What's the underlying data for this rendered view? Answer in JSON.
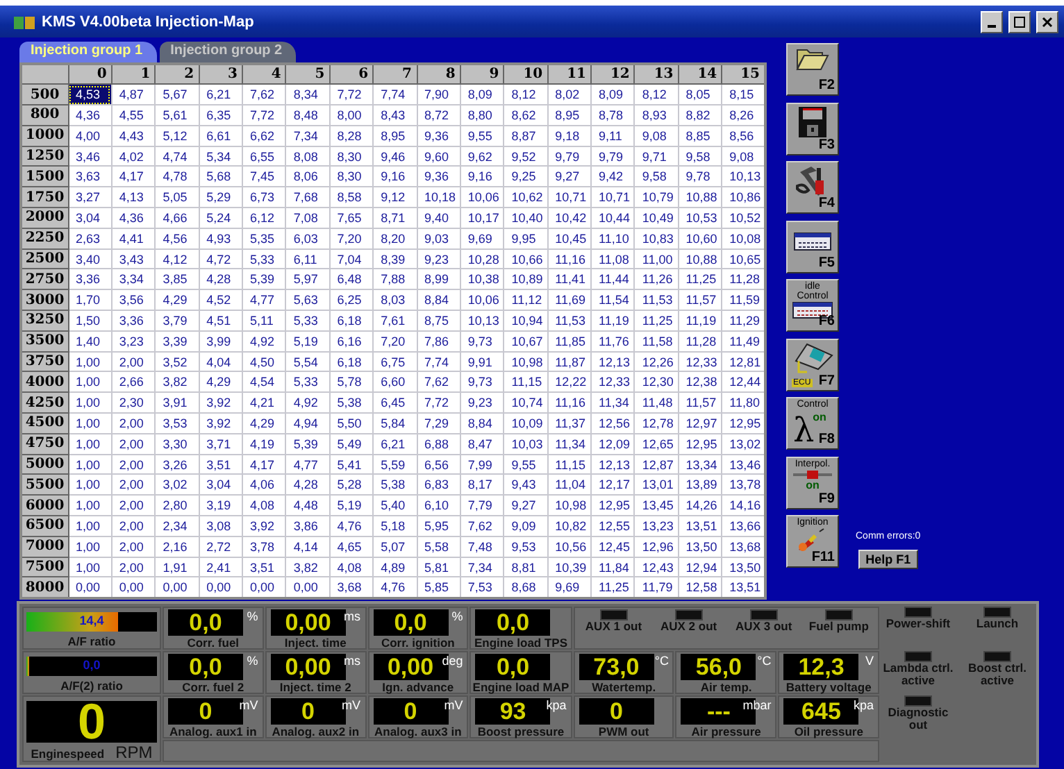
{
  "window": {
    "title": "KMS V4.00beta Injection-Map"
  },
  "tabs": [
    {
      "label": "Injection group 1",
      "selected": true
    },
    {
      "label": "Injection group 2",
      "selected": false
    }
  ],
  "table": {
    "columns": [
      "0",
      "1",
      "2",
      "3",
      "4",
      "5",
      "6",
      "7",
      "8",
      "9",
      "10",
      "11",
      "12",
      "13",
      "14",
      "15"
    ],
    "rows": [
      {
        "label": "500",
        "cells": [
          {
            "value": "4,53",
            "selected": true
          },
          {
            "value": "4,87",
            "selected": false
          },
          {
            "value": "5,67",
            "selected": false
          },
          {
            "value": "6,21",
            "selected": false
          },
          {
            "value": "7,62",
            "selected": false
          },
          {
            "value": "8,34",
            "selected": false
          },
          {
            "value": "7,72",
            "selected": false
          },
          {
            "value": "7,74",
            "selected": false
          },
          {
            "value": "7,90",
            "selected": false
          },
          {
            "value": "8,09",
            "selected": false
          },
          {
            "value": "8,12",
            "selected": false
          },
          {
            "value": "8,02",
            "selected": false
          },
          {
            "value": "8,09",
            "selected": false
          },
          {
            "value": "8,12",
            "selected": false
          },
          {
            "value": "8,05",
            "selected": false
          },
          {
            "value": "8,15",
            "selected": false
          }
        ]
      },
      {
        "label": "800",
        "cells": [
          {
            "value": "4,36",
            "selected": false
          },
          {
            "value": "4,55",
            "selected": false
          },
          {
            "value": "5,61",
            "selected": false
          },
          {
            "value": "6,35",
            "selected": false
          },
          {
            "value": "7,72",
            "selected": false
          },
          {
            "value": "8,48",
            "selected": false
          },
          {
            "value": "8,00",
            "selected": false
          },
          {
            "value": "8,43",
            "selected": false
          },
          {
            "value": "8,72",
            "selected": false
          },
          {
            "value": "8,80",
            "selected": false
          },
          {
            "value": "8,62",
            "selected": false
          },
          {
            "value": "8,95",
            "selected": false
          },
          {
            "value": "8,78",
            "selected": false
          },
          {
            "value": "8,93",
            "selected": false
          },
          {
            "value": "8,82",
            "selected": false
          },
          {
            "value": "8,26",
            "selected": false
          }
        ]
      },
      {
        "label": "1000",
        "cells": [
          {
            "value": "4,00",
            "selected": false
          },
          {
            "value": "4,43",
            "selected": false
          },
          {
            "value": "5,12",
            "selected": false
          },
          {
            "value": "6,61",
            "selected": false
          },
          {
            "value": "6,62",
            "selected": false
          },
          {
            "value": "7,34",
            "selected": false
          },
          {
            "value": "8,28",
            "selected": false
          },
          {
            "value": "8,95",
            "selected": false
          },
          {
            "value": "9,36",
            "selected": false
          },
          {
            "value": "9,55",
            "selected": false
          },
          {
            "value": "8,87",
            "selected": false
          },
          {
            "value": "9,18",
            "selected": false
          },
          {
            "value": "9,11",
            "selected": false
          },
          {
            "value": "9,08",
            "selected": false
          },
          {
            "value": "8,85",
            "selected": false
          },
          {
            "value": "8,56",
            "selected": false
          }
        ]
      },
      {
        "label": "1250",
        "cells": [
          {
            "value": "3,46",
            "selected": false
          },
          {
            "value": "4,02",
            "selected": false
          },
          {
            "value": "4,74",
            "selected": false
          },
          {
            "value": "5,34",
            "selected": false
          },
          {
            "value": "6,55",
            "selected": false
          },
          {
            "value": "8,08",
            "selected": false
          },
          {
            "value": "8,30",
            "selected": false
          },
          {
            "value": "9,46",
            "selected": false
          },
          {
            "value": "9,60",
            "selected": false
          },
          {
            "value": "9,62",
            "selected": false
          },
          {
            "value": "9,52",
            "selected": false
          },
          {
            "value": "9,79",
            "selected": false
          },
          {
            "value": "9,79",
            "selected": false
          },
          {
            "value": "9,71",
            "selected": false
          },
          {
            "value": "9,58",
            "selected": false
          },
          {
            "value": "9,08",
            "selected": false
          }
        ]
      },
      {
        "label": "1500",
        "cells": [
          {
            "value": "3,63",
            "selected": false
          },
          {
            "value": "4,17",
            "selected": false
          },
          {
            "value": "4,78",
            "selected": false
          },
          {
            "value": "5,68",
            "selected": false
          },
          {
            "value": "7,45",
            "selected": false
          },
          {
            "value": "8,06",
            "selected": false
          },
          {
            "value": "8,30",
            "selected": false
          },
          {
            "value": "9,16",
            "selected": false
          },
          {
            "value": "9,36",
            "selected": false
          },
          {
            "value": "9,16",
            "selected": false
          },
          {
            "value": "9,25",
            "selected": false
          },
          {
            "value": "9,27",
            "selected": false
          },
          {
            "value": "9,42",
            "selected": false
          },
          {
            "value": "9,58",
            "selected": false
          },
          {
            "value": "9,78",
            "selected": false
          },
          {
            "value": "10,13",
            "selected": false
          }
        ]
      },
      {
        "label": "1750",
        "cells": [
          {
            "value": "3,27",
            "selected": false
          },
          {
            "value": "4,13",
            "selected": false
          },
          {
            "value": "5,05",
            "selected": false
          },
          {
            "value": "5,29",
            "selected": false
          },
          {
            "value": "6,73",
            "selected": false
          },
          {
            "value": "7,68",
            "selected": false
          },
          {
            "value": "8,58",
            "selected": false
          },
          {
            "value": "9,12",
            "selected": false
          },
          {
            "value": "10,18",
            "selected": false
          },
          {
            "value": "10,06",
            "selected": false
          },
          {
            "value": "10,62",
            "selected": false
          },
          {
            "value": "10,71",
            "selected": false
          },
          {
            "value": "10,71",
            "selected": false
          },
          {
            "value": "10,79",
            "selected": false
          },
          {
            "value": "10,88",
            "selected": false
          },
          {
            "value": "10,86",
            "selected": false
          }
        ]
      },
      {
        "label": "2000",
        "cells": [
          {
            "value": "3,04",
            "selected": false
          },
          {
            "value": "4,36",
            "selected": false
          },
          {
            "value": "4,66",
            "selected": false
          },
          {
            "value": "5,24",
            "selected": false
          },
          {
            "value": "6,12",
            "selected": false
          },
          {
            "value": "7,08",
            "selected": false
          },
          {
            "value": "7,65",
            "selected": false
          },
          {
            "value": "8,71",
            "selected": false
          },
          {
            "value": "9,40",
            "selected": false
          },
          {
            "value": "10,17",
            "selected": false
          },
          {
            "value": "10,40",
            "selected": false
          },
          {
            "value": "10,42",
            "selected": false
          },
          {
            "value": "10,44",
            "selected": false
          },
          {
            "value": "10,49",
            "selected": false
          },
          {
            "value": "10,53",
            "selected": false
          },
          {
            "value": "10,52",
            "selected": false
          }
        ]
      },
      {
        "label": "2250",
        "cells": [
          {
            "value": "2,63",
            "selected": false
          },
          {
            "value": "4,41",
            "selected": false
          },
          {
            "value": "4,56",
            "selected": false
          },
          {
            "value": "4,93",
            "selected": false
          },
          {
            "value": "5,35",
            "selected": false
          },
          {
            "value": "6,03",
            "selected": false
          },
          {
            "value": "7,20",
            "selected": false
          },
          {
            "value": "8,20",
            "selected": false
          },
          {
            "value": "9,03",
            "selected": false
          },
          {
            "value": "9,69",
            "selected": false
          },
          {
            "value": "9,95",
            "selected": false
          },
          {
            "value": "10,45",
            "selected": false
          },
          {
            "value": "11,10",
            "selected": false
          },
          {
            "value": "10,83",
            "selected": false
          },
          {
            "value": "10,60",
            "selected": false
          },
          {
            "value": "10,08",
            "selected": false
          }
        ]
      },
      {
        "label": "2500",
        "cells": [
          {
            "value": "3,40",
            "selected": false
          },
          {
            "value": "3,43",
            "selected": false
          },
          {
            "value": "4,12",
            "selected": false
          },
          {
            "value": "4,72",
            "selected": false
          },
          {
            "value": "5,33",
            "selected": false
          },
          {
            "value": "6,11",
            "selected": false
          },
          {
            "value": "7,04",
            "selected": false
          },
          {
            "value": "8,39",
            "selected": false
          },
          {
            "value": "9,23",
            "selected": false
          },
          {
            "value": "10,28",
            "selected": false
          },
          {
            "value": "10,66",
            "selected": false
          },
          {
            "value": "11,16",
            "selected": false
          },
          {
            "value": "11,08",
            "selected": false
          },
          {
            "value": "11,00",
            "selected": false
          },
          {
            "value": "10,88",
            "selected": false
          },
          {
            "value": "10,65",
            "selected": false
          }
        ]
      },
      {
        "label": "2750",
        "cells": [
          {
            "value": "3,36",
            "selected": false
          },
          {
            "value": "3,34",
            "selected": false
          },
          {
            "value": "3,85",
            "selected": false
          },
          {
            "value": "4,28",
            "selected": false
          },
          {
            "value": "5,39",
            "selected": false
          },
          {
            "value": "5,97",
            "selected": false
          },
          {
            "value": "6,48",
            "selected": false
          },
          {
            "value": "7,88",
            "selected": false
          },
          {
            "value": "8,99",
            "selected": false
          },
          {
            "value": "10,38",
            "selected": false
          },
          {
            "value": "10,89",
            "selected": false
          },
          {
            "value": "11,41",
            "selected": false
          },
          {
            "value": "11,44",
            "selected": false
          },
          {
            "value": "11,26",
            "selected": false
          },
          {
            "value": "11,25",
            "selected": false
          },
          {
            "value": "11,28",
            "selected": false
          }
        ]
      },
      {
        "label": "3000",
        "cells": [
          {
            "value": "1,70",
            "selected": false
          },
          {
            "value": "3,56",
            "selected": false
          },
          {
            "value": "4,29",
            "selected": false
          },
          {
            "value": "4,52",
            "selected": false
          },
          {
            "value": "4,77",
            "selected": false
          },
          {
            "value": "5,63",
            "selected": false
          },
          {
            "value": "6,25",
            "selected": false
          },
          {
            "value": "8,03",
            "selected": false
          },
          {
            "value": "8,84",
            "selected": false
          },
          {
            "value": "10,06",
            "selected": false
          },
          {
            "value": "11,12",
            "selected": false
          },
          {
            "value": "11,69",
            "selected": false
          },
          {
            "value": "11,54",
            "selected": false
          },
          {
            "value": "11,53",
            "selected": false
          },
          {
            "value": "11,57",
            "selected": false
          },
          {
            "value": "11,59",
            "selected": false
          }
        ]
      },
      {
        "label": "3250",
        "cells": [
          {
            "value": "1,50",
            "selected": false
          },
          {
            "value": "3,36",
            "selected": false
          },
          {
            "value": "3,79",
            "selected": false
          },
          {
            "value": "4,51",
            "selected": false
          },
          {
            "value": "5,11",
            "selected": false
          },
          {
            "value": "5,33",
            "selected": false
          },
          {
            "value": "6,18",
            "selected": false
          },
          {
            "value": "7,61",
            "selected": false
          },
          {
            "value": "8,75",
            "selected": false
          },
          {
            "value": "10,13",
            "selected": false
          },
          {
            "value": "10,94",
            "selected": false
          },
          {
            "value": "11,53",
            "selected": false
          },
          {
            "value": "11,19",
            "selected": false
          },
          {
            "value": "11,25",
            "selected": false
          },
          {
            "value": "11,19",
            "selected": false
          },
          {
            "value": "11,29",
            "selected": false
          }
        ]
      },
      {
        "label": "3500",
        "cells": [
          {
            "value": "1,40",
            "selected": false
          },
          {
            "value": "3,23",
            "selected": false
          },
          {
            "value": "3,39",
            "selected": false
          },
          {
            "value": "3,99",
            "selected": false
          },
          {
            "value": "4,92",
            "selected": false
          },
          {
            "value": "5,19",
            "selected": false
          },
          {
            "value": "6,16",
            "selected": false
          },
          {
            "value": "7,20",
            "selected": false
          },
          {
            "value": "7,86",
            "selected": false
          },
          {
            "value": "9,73",
            "selected": false
          },
          {
            "value": "10,67",
            "selected": false
          },
          {
            "value": "11,85",
            "selected": false
          },
          {
            "value": "11,76",
            "selected": false
          },
          {
            "value": "11,58",
            "selected": false
          },
          {
            "value": "11,28",
            "selected": false
          },
          {
            "value": "11,49",
            "selected": false
          }
        ]
      },
      {
        "label": "3750",
        "cells": [
          {
            "value": "1,00",
            "selected": false
          },
          {
            "value": "2,00",
            "selected": false
          },
          {
            "value": "3,52",
            "selected": false
          },
          {
            "value": "4,04",
            "selected": false
          },
          {
            "value": "4,50",
            "selected": false
          },
          {
            "value": "5,54",
            "selected": false
          },
          {
            "value": "6,18",
            "selected": false
          },
          {
            "value": "6,75",
            "selected": false
          },
          {
            "value": "7,74",
            "selected": false
          },
          {
            "value": "9,91",
            "selected": false
          },
          {
            "value": "10,98",
            "selected": false
          },
          {
            "value": "11,87",
            "selected": false
          },
          {
            "value": "12,13",
            "selected": false
          },
          {
            "value": "12,26",
            "selected": false
          },
          {
            "value": "12,33",
            "selected": false
          },
          {
            "value": "12,81",
            "selected": false
          }
        ]
      },
      {
        "label": "4000",
        "cells": [
          {
            "value": "1,00",
            "selected": false
          },
          {
            "value": "2,66",
            "selected": false
          },
          {
            "value": "3,82",
            "selected": false
          },
          {
            "value": "4,29",
            "selected": false
          },
          {
            "value": "4,54",
            "selected": false
          },
          {
            "value": "5,33",
            "selected": false
          },
          {
            "value": "5,78",
            "selected": false
          },
          {
            "value": "6,60",
            "selected": false
          },
          {
            "value": "7,62",
            "selected": false
          },
          {
            "value": "9,73",
            "selected": false
          },
          {
            "value": "11,15",
            "selected": false
          },
          {
            "value": "12,22",
            "selected": false
          },
          {
            "value": "12,33",
            "selected": false
          },
          {
            "value": "12,30",
            "selected": false
          },
          {
            "value": "12,38",
            "selected": false
          },
          {
            "value": "12,44",
            "selected": false
          }
        ]
      },
      {
        "label": "4250",
        "cells": [
          {
            "value": "1,00",
            "selected": false
          },
          {
            "value": "2,30",
            "selected": false
          },
          {
            "value": "3,91",
            "selected": false
          },
          {
            "value": "3,92",
            "selected": false
          },
          {
            "value": "4,21",
            "selected": false
          },
          {
            "value": "4,92",
            "selected": false
          },
          {
            "value": "5,38",
            "selected": false
          },
          {
            "value": "6,45",
            "selected": false
          },
          {
            "value": "7,72",
            "selected": false
          },
          {
            "value": "9,23",
            "selected": false
          },
          {
            "value": "10,74",
            "selected": false
          },
          {
            "value": "11,16",
            "selected": false
          },
          {
            "value": "11,34",
            "selected": false
          },
          {
            "value": "11,48",
            "selected": false
          },
          {
            "value": "11,57",
            "selected": false
          },
          {
            "value": "11,80",
            "selected": false
          }
        ]
      },
      {
        "label": "4500",
        "cells": [
          {
            "value": "1,00",
            "selected": false
          },
          {
            "value": "2,00",
            "selected": false
          },
          {
            "value": "3,53",
            "selected": false
          },
          {
            "value": "3,92",
            "selected": false
          },
          {
            "value": "4,29",
            "selected": false
          },
          {
            "value": "4,94",
            "selected": false
          },
          {
            "value": "5,50",
            "selected": false
          },
          {
            "value": "5,84",
            "selected": false
          },
          {
            "value": "7,29",
            "selected": false
          },
          {
            "value": "8,84",
            "selected": false
          },
          {
            "value": "10,09",
            "selected": false
          },
          {
            "value": "11,37",
            "selected": false
          },
          {
            "value": "12,56",
            "selected": false
          },
          {
            "value": "12,78",
            "selected": false
          },
          {
            "value": "12,97",
            "selected": false
          },
          {
            "value": "12,95",
            "selected": false
          }
        ]
      },
      {
        "label": "4750",
        "cells": [
          {
            "value": "1,00",
            "selected": false
          },
          {
            "value": "2,00",
            "selected": false
          },
          {
            "value": "3,30",
            "selected": false
          },
          {
            "value": "3,71",
            "selected": false
          },
          {
            "value": "4,19",
            "selected": false
          },
          {
            "value": "5,39",
            "selected": false
          },
          {
            "value": "5,49",
            "selected": false
          },
          {
            "value": "6,21",
            "selected": false
          },
          {
            "value": "6,88",
            "selected": false
          },
          {
            "value": "8,47",
            "selected": false
          },
          {
            "value": "10,03",
            "selected": false
          },
          {
            "value": "11,34",
            "selected": false
          },
          {
            "value": "12,09",
            "selected": false
          },
          {
            "value": "12,65",
            "selected": false
          },
          {
            "value": "12,95",
            "selected": false
          },
          {
            "value": "13,02",
            "selected": false
          }
        ]
      },
      {
        "label": "5000",
        "cells": [
          {
            "value": "1,00",
            "selected": false
          },
          {
            "value": "2,00",
            "selected": false
          },
          {
            "value": "3,26",
            "selected": false
          },
          {
            "value": "3,51",
            "selected": false
          },
          {
            "value": "4,17",
            "selected": false
          },
          {
            "value": "4,77",
            "selected": false
          },
          {
            "value": "5,41",
            "selected": false
          },
          {
            "value": "5,59",
            "selected": false
          },
          {
            "value": "6,56",
            "selected": false
          },
          {
            "value": "7,99",
            "selected": false
          },
          {
            "value": "9,55",
            "selected": false
          },
          {
            "value": "11,15",
            "selected": false
          },
          {
            "value": "12,13",
            "selected": false
          },
          {
            "value": "12,87",
            "selected": false
          },
          {
            "value": "13,34",
            "selected": false
          },
          {
            "value": "13,46",
            "selected": false
          }
        ]
      },
      {
        "label": "5500",
        "cells": [
          {
            "value": "1,00",
            "selected": false
          },
          {
            "value": "2,00",
            "selected": false
          },
          {
            "value": "3,02",
            "selected": false
          },
          {
            "value": "3,04",
            "selected": false
          },
          {
            "value": "4,06",
            "selected": false
          },
          {
            "value": "4,28",
            "selected": false
          },
          {
            "value": "5,28",
            "selected": false
          },
          {
            "value": "5,38",
            "selected": false
          },
          {
            "value": "6,83",
            "selected": false
          },
          {
            "value": "8,17",
            "selected": false
          },
          {
            "value": "9,43",
            "selected": false
          },
          {
            "value": "11,04",
            "selected": false
          },
          {
            "value": "12,17",
            "selected": false
          },
          {
            "value": "13,01",
            "selected": false
          },
          {
            "value": "13,89",
            "selected": false
          },
          {
            "value": "13,78",
            "selected": false
          }
        ]
      },
      {
        "label": "6000",
        "cells": [
          {
            "value": "1,00",
            "selected": false
          },
          {
            "value": "2,00",
            "selected": false
          },
          {
            "value": "2,80",
            "selected": false
          },
          {
            "value": "3,19",
            "selected": false
          },
          {
            "value": "4,08",
            "selected": false
          },
          {
            "value": "4,48",
            "selected": false
          },
          {
            "value": "5,19",
            "selected": false
          },
          {
            "value": "5,40",
            "selected": false
          },
          {
            "value": "6,10",
            "selected": false
          },
          {
            "value": "7,79",
            "selected": false
          },
          {
            "value": "9,27",
            "selected": false
          },
          {
            "value": "10,98",
            "selected": false
          },
          {
            "value": "12,95",
            "selected": false
          },
          {
            "value": "13,45",
            "selected": false
          },
          {
            "value": "14,26",
            "selected": false
          },
          {
            "value": "14,16",
            "selected": false
          }
        ]
      },
      {
        "label": "6500",
        "cells": [
          {
            "value": "1,00",
            "selected": false
          },
          {
            "value": "2,00",
            "selected": false
          },
          {
            "value": "2,34",
            "selected": false
          },
          {
            "value": "3,08",
            "selected": false
          },
          {
            "value": "3,92",
            "selected": false
          },
          {
            "value": "3,86",
            "selected": false
          },
          {
            "value": "4,76",
            "selected": false
          },
          {
            "value": "5,18",
            "selected": false
          },
          {
            "value": "5,95",
            "selected": false
          },
          {
            "value": "7,62",
            "selected": false
          },
          {
            "value": "9,09",
            "selected": false
          },
          {
            "value": "10,82",
            "selected": false
          },
          {
            "value": "12,55",
            "selected": false
          },
          {
            "value": "13,23",
            "selected": false
          },
          {
            "value": "13,51",
            "selected": false
          },
          {
            "value": "13,66",
            "selected": false
          }
        ]
      },
      {
        "label": "7000",
        "cells": [
          {
            "value": "1,00",
            "selected": false
          },
          {
            "value": "2,00",
            "selected": false
          },
          {
            "value": "2,16",
            "selected": false
          },
          {
            "value": "2,72",
            "selected": false
          },
          {
            "value": "3,78",
            "selected": false
          },
          {
            "value": "4,14",
            "selected": false
          },
          {
            "value": "4,65",
            "selected": false
          },
          {
            "value": "5,07",
            "selected": false
          },
          {
            "value": "5,58",
            "selected": false
          },
          {
            "value": "7,48",
            "selected": false
          },
          {
            "value": "9,53",
            "selected": false
          },
          {
            "value": "10,56",
            "selected": false
          },
          {
            "value": "12,45",
            "selected": false
          },
          {
            "value": "12,96",
            "selected": false
          },
          {
            "value": "13,50",
            "selected": false
          },
          {
            "value": "13,68",
            "selected": false
          }
        ]
      },
      {
        "label": "7500",
        "cells": [
          {
            "value": "1,00",
            "selected": false
          },
          {
            "value": "2,00",
            "selected": false
          },
          {
            "value": "1,91",
            "selected": false
          },
          {
            "value": "2,41",
            "selected": false
          },
          {
            "value": "3,51",
            "selected": false
          },
          {
            "value": "3,82",
            "selected": false
          },
          {
            "value": "4,08",
            "selected": false
          },
          {
            "value": "4,89",
            "selected": false
          },
          {
            "value": "5,81",
            "selected": false
          },
          {
            "value": "7,34",
            "selected": false
          },
          {
            "value": "8,81",
            "selected": false
          },
          {
            "value": "10,39",
            "selected": false
          },
          {
            "value": "11,84",
            "selected": false
          },
          {
            "value": "12,43",
            "selected": false
          },
          {
            "value": "12,94",
            "selected": false
          },
          {
            "value": "13,50",
            "selected": false
          }
        ]
      },
      {
        "label": "8000",
        "cells": [
          {
            "value": "0,00",
            "selected": false
          },
          {
            "value": "0,00",
            "selected": false
          },
          {
            "value": "0,00",
            "selected": false
          },
          {
            "value": "0,00",
            "selected": false
          },
          {
            "value": "0,00",
            "selected": false
          },
          {
            "value": "0,00",
            "selected": false
          },
          {
            "value": "3,68",
            "selected": false
          },
          {
            "value": "4,76",
            "selected": false
          },
          {
            "value": "5,85",
            "selected": false
          },
          {
            "value": "7,53",
            "selected": false
          },
          {
            "value": "8,68",
            "selected": false
          },
          {
            "value": "9,69",
            "selected": false
          },
          {
            "value": "11,25",
            "selected": false
          },
          {
            "value": "11,79",
            "selected": false
          },
          {
            "value": "12,58",
            "selected": false
          },
          {
            "value": "13,51",
            "selected": false
          }
        ]
      }
    ]
  },
  "toolbar": [
    {
      "kind": "open",
      "key": "F2"
    },
    {
      "kind": "save",
      "key": "F3"
    },
    {
      "kind": "tools",
      "key": "F4"
    },
    {
      "kind": "table",
      "key": "F5"
    },
    {
      "kind": "idle",
      "caption": "idle Control",
      "key": "F6"
    },
    {
      "kind": "ecu",
      "badge": "ECU",
      "key": "F7"
    },
    {
      "kind": "lambda",
      "caption": "Control",
      "symbol": "λ",
      "status": "on",
      "key": "F8"
    },
    {
      "kind": "interpol",
      "caption": "Interpol.",
      "status": "on",
      "key": "F9"
    },
    {
      "kind": "ignition",
      "caption": "Ignition",
      "key": "F11"
    }
  ],
  "comm_errors": "Comm errors:0",
  "help_button": "Help F1",
  "gauges": [
    {
      "kind": "bar",
      "value": "14,4",
      "level": 0.7,
      "label": "A/F ratio"
    },
    {
      "kind": "digital",
      "value": "0,0",
      "unit": "%",
      "label": "Corr. fuel"
    },
    {
      "kind": "digital",
      "value": "0,00",
      "unit": "ms",
      "label": "Inject. time"
    },
    {
      "kind": "digital",
      "value": "0,0",
      "unit": "%",
      "label": "Corr. ignition"
    },
    {
      "kind": "digital",
      "value": "0,0",
      "label": "Engine load TPS"
    },
    {
      "kind": "lamps",
      "lamps": [
        {
          "label": "AUX 1 out",
          "on": false
        },
        {
          "label": "AUX 2 out",
          "on": false
        },
        {
          "label": "AUX 3 out",
          "on": false
        },
        {
          "label": "Fuel pump",
          "on": false
        }
      ]
    },
    {
      "kind": "bar",
      "value": "0,0",
      "level": 0,
      "label": "A/F(2) ratio"
    },
    {
      "kind": "digital",
      "value": "0,0",
      "unit": "%",
      "label": "Corr. fuel 2"
    },
    {
      "kind": "digital",
      "value": "0,00",
      "unit": "ms",
      "label": "Inject. time 2"
    },
    {
      "kind": "digital",
      "value": "0,00",
      "unit": "deg",
      "label": "Ign. advance"
    },
    {
      "kind": "digital",
      "value": "0,0",
      "label": "Engine load MAP"
    },
    {
      "kind": "digital",
      "value": "73,0",
      "unit": "°C",
      "label": "Watertemp."
    },
    {
      "kind": "digital",
      "value": "56,0",
      "unit": "°C",
      "label": "Air temp."
    },
    {
      "kind": "digital",
      "value": "12,3",
      "unit": "V",
      "label": "Battery voltage"
    },
    {
      "kind": "big",
      "value": "0",
      "label": "Enginespeed",
      "unit": "RPM"
    },
    {
      "kind": "digital",
      "value": "0",
      "unit": "mV",
      "label": "Analog. aux1 in"
    },
    {
      "kind": "digital",
      "value": "0",
      "unit": "mV",
      "label": "Analog. aux2 in"
    },
    {
      "kind": "digital",
      "value": "0",
      "unit": "mV",
      "label": "Analog. aux3 in"
    },
    {
      "kind": "digital",
      "value": "93",
      "unit": "kpa",
      "label": "Boost pressure"
    },
    {
      "kind": "digital",
      "value": "0",
      "label": "PWM out"
    },
    {
      "kind": "digital",
      "value": "---",
      "unit": "mbar",
      "label": "Air pressure"
    },
    {
      "kind": "digital",
      "value": "645",
      "unit": "kpa",
      "label": "Oil pressure"
    }
  ],
  "side_lamps": [
    {
      "label": "Power-shift",
      "on": false
    },
    {
      "label": "Launch",
      "on": false
    },
    {
      "label": "Lambda ctrl. active",
      "on": false
    },
    {
      "label": "Boost ctrl. active",
      "on": false
    },
    {
      "label": "Diagnostic out",
      "on": false
    }
  ]
}
